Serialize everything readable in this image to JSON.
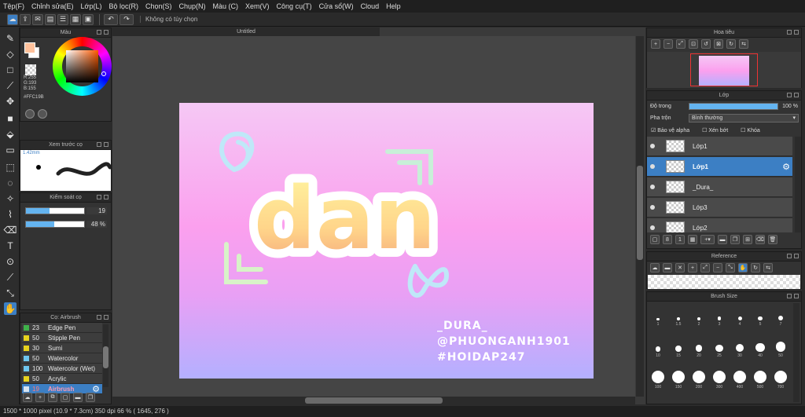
{
  "menu": [
    "Tệp(F)",
    "Chỉnh sửa(E)",
    "Lớp(L)",
    "Bộ lọc(R)",
    "Chọn(S)",
    "Chụp(N)",
    "Màu (C)",
    "Xem(V)",
    "Công cụ(T)",
    "Cửa sổ(W)",
    "Cloud",
    "Help"
  ],
  "toolbar": {
    "hint": "Không có tùy chọn",
    "undo_icon": "undo-icon",
    "redo_icon": "redo-icon"
  },
  "color_panel": {
    "title": "Màu",
    "r": "R:255",
    "g": "G:193",
    "b": "B:155",
    "hex": "#FFC19B",
    "fg_color": "#ffc19b"
  },
  "brush_preview": {
    "title": "Xem trước cọ",
    "size": "1.42mm"
  },
  "brush_control": {
    "title": "Kiểm soát cọ",
    "size_value": "19",
    "size_fill": 0.4,
    "density_value": "48 %",
    "density_fill": 0.48
  },
  "brush_list": {
    "title": "Cọ: Airbrush",
    "items": [
      {
        "num": "23",
        "name": "Edge Pen",
        "color": "#3fb24a"
      },
      {
        "num": "50",
        "name": "Stipple Pen",
        "color": "#e6d21e"
      },
      {
        "num": "30",
        "name": "Sumi",
        "color": "#e6d21e"
      },
      {
        "num": "50",
        "name": "Watercolor",
        "color": "#6ec6f0"
      },
      {
        "num": "100",
        "name": "Watercolor (Wet)",
        "color": "#6ec6f0"
      },
      {
        "num": "50",
        "name": "Acrylic",
        "color": "#e6d21e"
      },
      {
        "num": "19",
        "name": "Airbrush",
        "color": "#d9e4f0"
      }
    ]
  },
  "document": {
    "tab_title": "Untitled"
  },
  "artwork": {
    "word": "dan",
    "line1": "_DURA_",
    "line2": "@PHUONGANH1901",
    "line3": "#HOIDAP247"
  },
  "navigator": {
    "title": "Hoa tiêu"
  },
  "layer_panel": {
    "title": "Lớp",
    "opacity_label": "Độ trong",
    "opacity_value": "100 %",
    "opacity_fill": 1.0,
    "blend_label": "Pha trộn",
    "blend_value": "Bình thường",
    "protect_alpha": "Bảo vệ alpha",
    "clipping": "Xén bớt",
    "lock": "Khóa",
    "layers": [
      {
        "name": "Lớp1",
        "selected": false
      },
      {
        "name": "Lớp1",
        "selected": true
      },
      {
        "name": "_Dura_",
        "selected": false
      },
      {
        "name": "Lớp3",
        "selected": false
      },
      {
        "name": "Lớp2",
        "selected": false
      }
    ]
  },
  "reference": {
    "title": "Reference"
  },
  "brush_size": {
    "title": "Brush Size",
    "sizes": [
      "1",
      "1.5",
      "2",
      "3",
      "4",
      "5",
      "7",
      "10",
      "15",
      "20",
      "25",
      "30",
      "40",
      "50",
      "100",
      "150",
      "200",
      "300",
      "400",
      "500",
      "700"
    ]
  },
  "status": {
    "text": "1500 * 1000 pixel   (10.9 * 7.3cm)   350 dpi   66 %   ( 1645, 276 )"
  }
}
